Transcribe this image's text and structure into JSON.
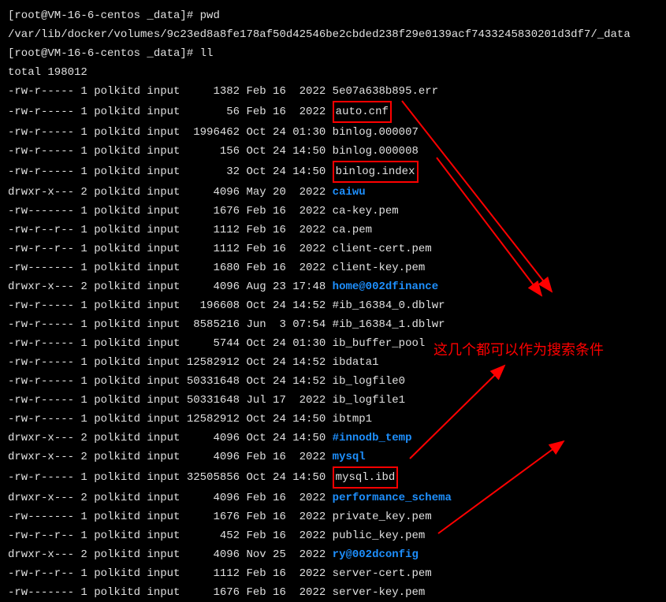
{
  "prompt1": "[root@VM-16-6-centos _data]# ",
  "cmd1": "pwd",
  "pwd_output": "/var/lib/docker/volumes/9c23ed8a8fe178af50d42546be2cbded238f29e0139acf7433245830201d3df7/_data",
  "prompt2": "[root@VM-16-6-centos _data]# ",
  "cmd2": "ll",
  "total_line": "total 198012",
  "annotation_text": "这几个都可以作为搜索条件",
  "files": [
    {
      "perm": "-rw-r-----",
      "links": "1",
      "owner": "polkitd",
      "group": "input",
      "size": "    1382",
      "date": "Feb 16  2022",
      "name": "5e07a638b895.err",
      "dir": false,
      "box": false
    },
    {
      "perm": "-rw-r-----",
      "links": "1",
      "owner": "polkitd",
      "group": "input",
      "size": "      56",
      "date": "Feb 16  2022",
      "name": "auto.cnf",
      "dir": false,
      "box": true
    },
    {
      "perm": "-rw-r-----",
      "links": "1",
      "owner": "polkitd",
      "group": "input",
      "size": " 1996462",
      "date": "Oct 24 01:30",
      "name": "binlog.000007",
      "dir": false,
      "box": false
    },
    {
      "perm": "-rw-r-----",
      "links": "1",
      "owner": "polkitd",
      "group": "input",
      "size": "     156",
      "date": "Oct 24 14:50",
      "name": "binlog.000008",
      "dir": false,
      "box": false
    },
    {
      "perm": "-rw-r-----",
      "links": "1",
      "owner": "polkitd",
      "group": "input",
      "size": "      32",
      "date": "Oct 24 14:50",
      "name": "binlog.index",
      "dir": false,
      "box": true
    },
    {
      "perm": "drwxr-x---",
      "links": "2",
      "owner": "polkitd",
      "group": "input",
      "size": "    4096",
      "date": "May 20  2022",
      "name": "caiwu",
      "dir": true,
      "box": false
    },
    {
      "perm": "-rw-------",
      "links": "1",
      "owner": "polkitd",
      "group": "input",
      "size": "    1676",
      "date": "Feb 16  2022",
      "name": "ca-key.pem",
      "dir": false,
      "box": false
    },
    {
      "perm": "-rw-r--r--",
      "links": "1",
      "owner": "polkitd",
      "group": "input",
      "size": "    1112",
      "date": "Feb 16  2022",
      "name": "ca.pem",
      "dir": false,
      "box": false
    },
    {
      "perm": "-rw-r--r--",
      "links": "1",
      "owner": "polkitd",
      "group": "input",
      "size": "    1112",
      "date": "Feb 16  2022",
      "name": "client-cert.pem",
      "dir": false,
      "box": false
    },
    {
      "perm": "-rw-------",
      "links": "1",
      "owner": "polkitd",
      "group": "input",
      "size": "    1680",
      "date": "Feb 16  2022",
      "name": "client-key.pem",
      "dir": false,
      "box": false
    },
    {
      "perm": "drwxr-x---",
      "links": "2",
      "owner": "polkitd",
      "group": "input",
      "size": "    4096",
      "date": "Aug 23 17:48",
      "name": "home@002dfinance",
      "dir": true,
      "box": false
    },
    {
      "perm": "-rw-r-----",
      "links": "1",
      "owner": "polkitd",
      "group": "input",
      "size": "  196608",
      "date": "Oct 24 14:52",
      "name": "#ib_16384_0.dblwr",
      "dir": false,
      "box": false
    },
    {
      "perm": "-rw-r-----",
      "links": "1",
      "owner": "polkitd",
      "group": "input",
      "size": " 8585216",
      "date": "Jun  3 07:54",
      "name": "#ib_16384_1.dblwr",
      "dir": false,
      "box": false
    },
    {
      "perm": "-rw-r-----",
      "links": "1",
      "owner": "polkitd",
      "group": "input",
      "size": "    5744",
      "date": "Oct 24 01:30",
      "name": "ib_buffer_pool",
      "dir": false,
      "box": false
    },
    {
      "perm": "-rw-r-----",
      "links": "1",
      "owner": "polkitd",
      "group": "input",
      "size": "12582912",
      "date": "Oct 24 14:52",
      "name": "ibdata1",
      "dir": false,
      "box": false
    },
    {
      "perm": "-rw-r-----",
      "links": "1",
      "owner": "polkitd",
      "group": "input",
      "size": "50331648",
      "date": "Oct 24 14:52",
      "name": "ib_logfile0",
      "dir": false,
      "box": false
    },
    {
      "perm": "-rw-r-----",
      "links": "1",
      "owner": "polkitd",
      "group": "input",
      "size": "50331648",
      "date": "Jul 17  2022",
      "name": "ib_logfile1",
      "dir": false,
      "box": false
    },
    {
      "perm": "-rw-r-----",
      "links": "1",
      "owner": "polkitd",
      "group": "input",
      "size": "12582912",
      "date": "Oct 24 14:50",
      "name": "ibtmp1",
      "dir": false,
      "box": false
    },
    {
      "perm": "drwxr-x---",
      "links": "2",
      "owner": "polkitd",
      "group": "input",
      "size": "    4096",
      "date": "Oct 24 14:50",
      "name": "#innodb_temp",
      "dir": true,
      "box": false
    },
    {
      "perm": "drwxr-x---",
      "links": "2",
      "owner": "polkitd",
      "group": "input",
      "size": "    4096",
      "date": "Feb 16  2022",
      "name": "mysql",
      "dir": true,
      "box": false
    },
    {
      "perm": "-rw-r-----",
      "links": "1",
      "owner": "polkitd",
      "group": "input",
      "size": "32505856",
      "date": "Oct 24 14:50",
      "name": "mysql.ibd",
      "dir": false,
      "box": true
    },
    {
      "perm": "drwxr-x---",
      "links": "2",
      "owner": "polkitd",
      "group": "input",
      "size": "    4096",
      "date": "Feb 16  2022",
      "name": "performance_schema",
      "dir": true,
      "box": false
    },
    {
      "perm": "-rw-------",
      "links": "1",
      "owner": "polkitd",
      "group": "input",
      "size": "    1676",
      "date": "Feb 16  2022",
      "name": "private_key.pem",
      "dir": false,
      "box": false
    },
    {
      "perm": "-rw-r--r--",
      "links": "1",
      "owner": "polkitd",
      "group": "input",
      "size": "     452",
      "date": "Feb 16  2022",
      "name": "public_key.pem",
      "dir": false,
      "box": false
    },
    {
      "perm": "drwxr-x---",
      "links": "2",
      "owner": "polkitd",
      "group": "input",
      "size": "    4096",
      "date": "Nov 25  2022",
      "name": "ry@002dconfig",
      "dir": true,
      "box": false
    },
    {
      "perm": "-rw-r--r--",
      "links": "1",
      "owner": "polkitd",
      "group": "input",
      "size": "    1112",
      "date": "Feb 16  2022",
      "name": "server-cert.pem",
      "dir": false,
      "box": false
    },
    {
      "perm": "-rw-------",
      "links": "1",
      "owner": "polkitd",
      "group": "input",
      "size": "    1676",
      "date": "Feb 16  2022",
      "name": "server-key.pem",
      "dir": false,
      "box": false
    }
  ]
}
